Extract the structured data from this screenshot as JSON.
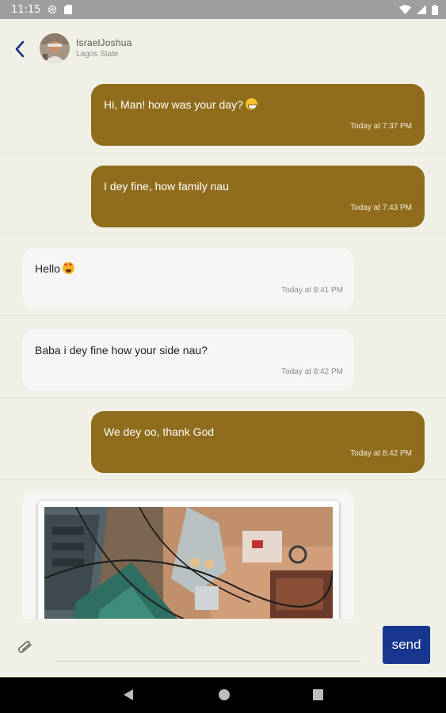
{
  "status_bar": {
    "time": "11:15",
    "icons": [
      "settings-icon",
      "sd-card-icon",
      "wifi-icon",
      "cell-signal-icon",
      "battery-icon"
    ]
  },
  "header": {
    "back_icon": "chevron-left-icon",
    "contact_name": "IsraelJoshua",
    "contact_location": "Lagos State"
  },
  "messages": [
    {
      "direction": "sent",
      "text": "Hi, Man! how was your day?",
      "emoji": "grinning-emoji",
      "time": "Today at 7:37 PM"
    },
    {
      "direction": "sent",
      "text": "I dey fine, how family nau",
      "time": "Today at 7:43 PM"
    },
    {
      "direction": "received",
      "text": "Hello",
      "emoji": "star-struck-emoji",
      "time": "Today at 8:41 PM"
    },
    {
      "direction": "received",
      "text": "Baba i dey fine how your side nau?",
      "time": "Today at 8:42 PM"
    },
    {
      "direction": "sent",
      "text": "We dey oo, thank God",
      "time": "Today at 8:42 PM"
    },
    {
      "direction": "received",
      "type": "image"
    }
  ],
  "input": {
    "attach_icon": "paperclip-icon",
    "placeholder": "",
    "value": "",
    "send_label": "send"
  },
  "nav_bar": {
    "icons": [
      "back-triangle-icon",
      "home-circle-icon",
      "recents-square-icon"
    ]
  },
  "colors": {
    "background": "#f1f0e6",
    "sent_bubble": "#8f6d1d",
    "received_bubble": "#f6f6f4",
    "send_button": "#17368f",
    "back_arrow": "#1a2f8a"
  }
}
